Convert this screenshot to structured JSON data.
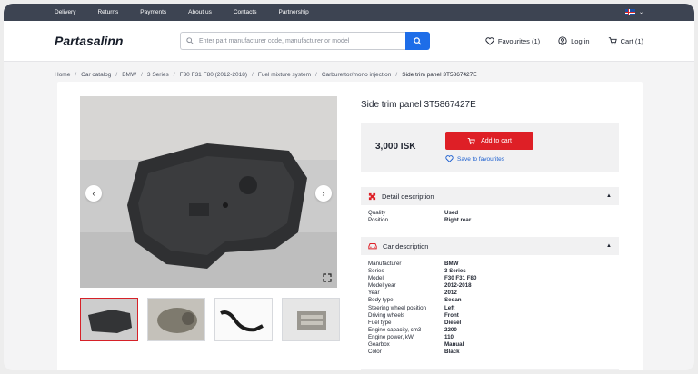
{
  "topbar": {
    "links": [
      "Delivery",
      "Returns",
      "Payments",
      "About us",
      "Contacts",
      "Partnership"
    ],
    "language_icon": "iceland-flag-icon"
  },
  "header": {
    "logo": "Partasalinn",
    "search_placeholder": "Enter part manufacturer code, manufacturer or model",
    "favourites_label": "Favourites (1)",
    "login_label": "Log in",
    "cart_label": "Cart (1)"
  },
  "breadcrumbs": [
    "Home",
    "Car catalog",
    "BMW",
    "3 Series",
    "F30 F31 F80 (2012-2018)",
    "Fuel mixture system",
    "Carburettor/mono injection",
    "Side trim panel 3T5867427E"
  ],
  "product": {
    "title": "Side trim panel 3T5867427E",
    "price": "3,000 ISK",
    "add_to_cart": "Add to cart",
    "save_to_favourites": "Save to favourites"
  },
  "detail_section": {
    "heading": "Detail description",
    "rows": [
      {
        "k": "Quality",
        "v": "Used"
      },
      {
        "k": "Position",
        "v": "Right rear"
      }
    ]
  },
  "car_section": {
    "heading": "Car description",
    "rows": [
      {
        "k": "Manufacturer",
        "v": "BMW"
      },
      {
        "k": "Series",
        "v": "3 Series"
      },
      {
        "k": "Model",
        "v": "F30 F31 F80"
      },
      {
        "k": "Model year",
        "v": "2012-2018"
      },
      {
        "k": "Year",
        "v": "2012"
      },
      {
        "k": "Body type",
        "v": "Sedan"
      },
      {
        "k": "Steering wheel position",
        "v": "Left"
      },
      {
        "k": "Driving wheels",
        "v": "Front"
      },
      {
        "k": "Fuel type",
        "v": "Diesel"
      },
      {
        "k": "Engine capacity, cm3",
        "v": "2200"
      },
      {
        "k": "Engine power, kW",
        "v": "110"
      },
      {
        "k": "Gearbox",
        "v": "Manual"
      },
      {
        "k": "Color",
        "v": "Black"
      }
    ]
  },
  "colors": {
    "accent_red": "#de1f26",
    "accent_blue": "#1e6de8",
    "topbar": "#3d4452"
  }
}
